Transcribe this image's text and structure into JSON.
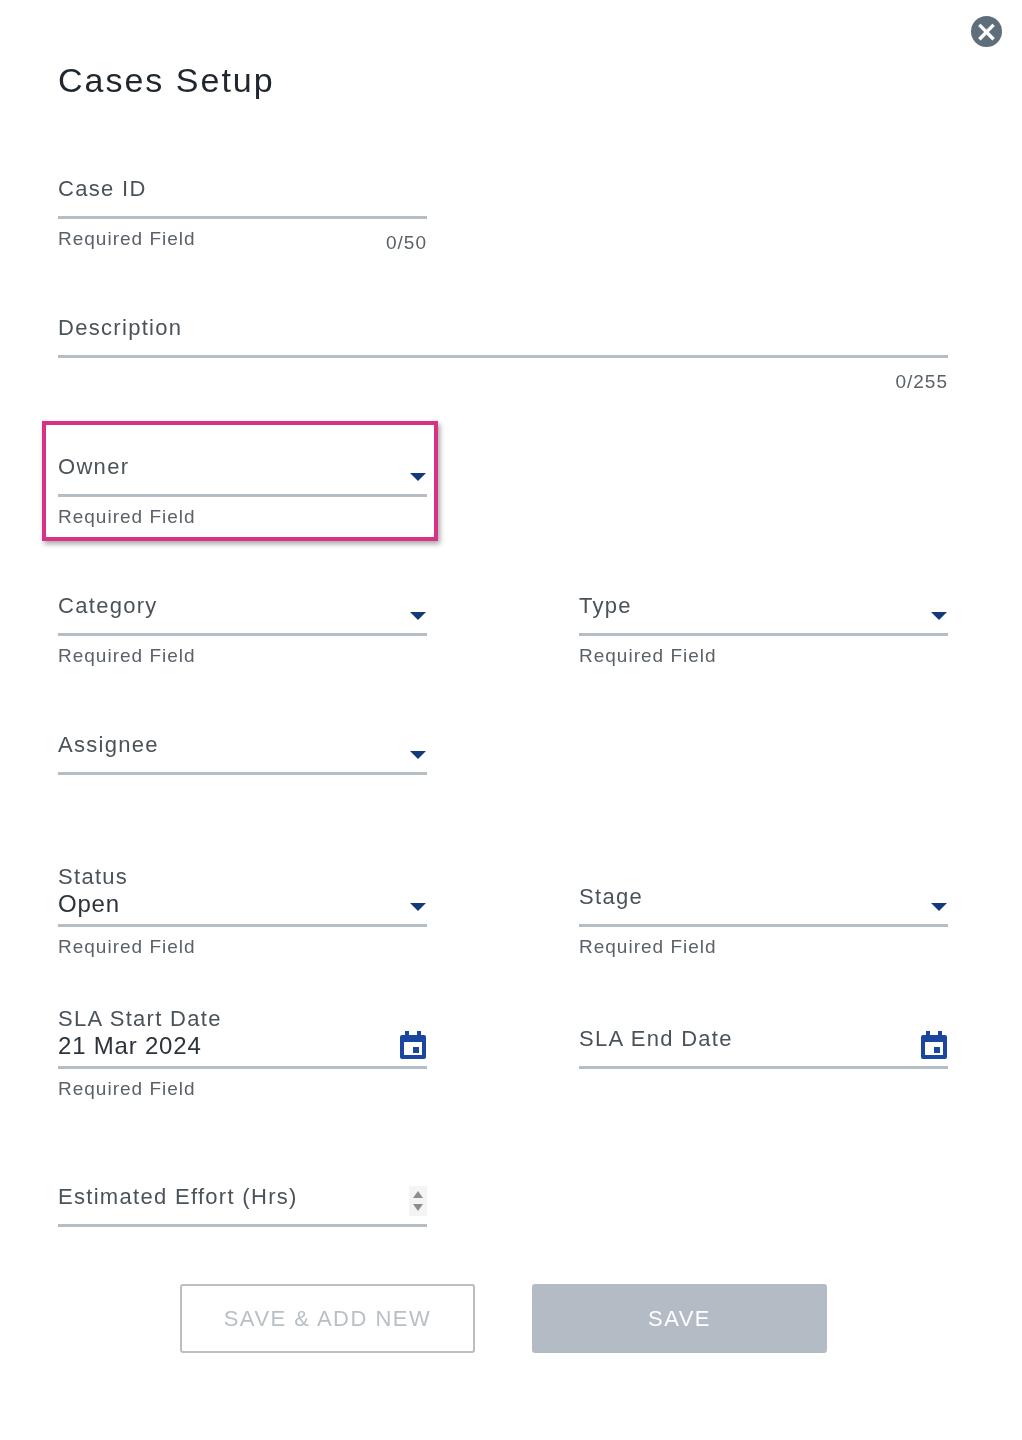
{
  "dialog": {
    "title": "Cases Setup",
    "close": "×"
  },
  "rows": [
    {
      "fields": [
        {
          "kind": "text",
          "label": "Case ID",
          "hint": "Required Field",
          "counter": "0/50",
          "wide": false,
          "highlighted": false
        }
      ]
    },
    {
      "fields": [
        {
          "kind": "text",
          "label": "Description",
          "counter": "0/255",
          "wide": true,
          "highlighted": false
        }
      ]
    },
    {
      "fields": [
        {
          "kind": "select",
          "label": "Owner",
          "hint": "Required Field",
          "wide": false,
          "highlighted": true
        }
      ]
    },
    {
      "fields": [
        {
          "kind": "select",
          "label": "Category",
          "hint": "Required Field",
          "wide": false,
          "highlighted": false
        },
        {
          "kind": "select",
          "label": "Type",
          "hint": "Required Field",
          "wide": false,
          "highlighted": false
        }
      ]
    },
    {
      "fields": [
        {
          "kind": "select",
          "label": "Assignee",
          "wide": false,
          "highlighted": false
        }
      ]
    },
    {
      "fields": [
        {
          "kind": "select",
          "label": "Status",
          "value": "Open",
          "hint": "Required Field",
          "wide": false,
          "highlighted": false
        },
        {
          "kind": "select",
          "label": "Stage",
          "hint": "Required Field",
          "wide": false,
          "highlighted": false
        }
      ]
    },
    {
      "fields": [
        {
          "kind": "date",
          "label": "SLA Start Date",
          "value": "21 Mar 2024",
          "hint": "Required Field",
          "wide": false,
          "highlighted": false
        },
        {
          "kind": "date",
          "label": "SLA End Date",
          "wide": false,
          "highlighted": false
        }
      ]
    },
    {
      "fields": [
        {
          "kind": "number",
          "label": "Estimated Effort (Hrs)",
          "wide": false,
          "highlighted": false
        }
      ]
    }
  ],
  "buttons": [
    {
      "label": "SAVE & ADD NEW",
      "kind": "outlined",
      "disabled": true
    },
    {
      "label": "SAVE",
      "kind": "filled",
      "disabled": true
    }
  ]
}
